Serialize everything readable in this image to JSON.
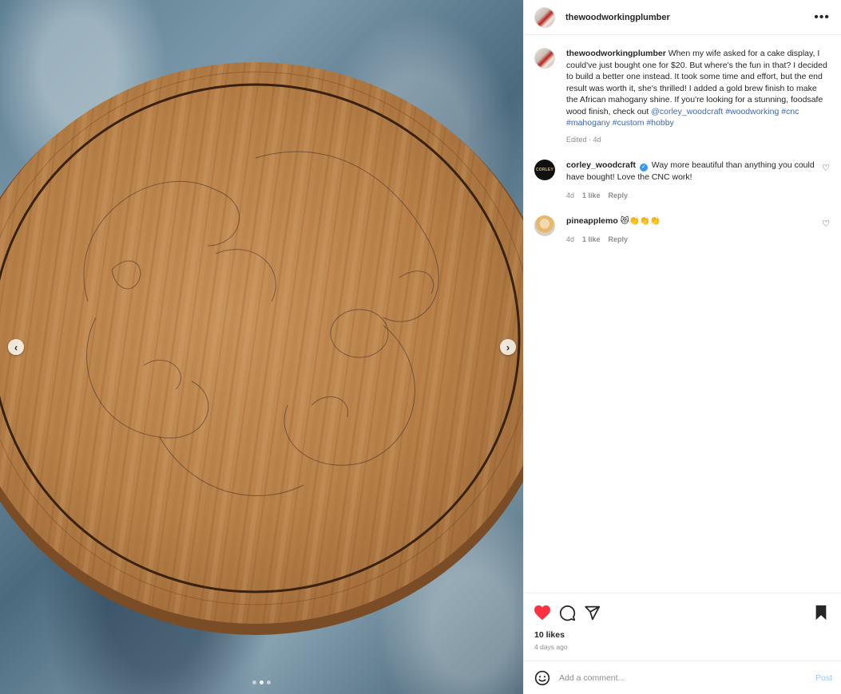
{
  "post": {
    "owner": "thewoodworkingplumber",
    "more_icon": "more-horizontal-icon"
  },
  "caption": {
    "username": "thewoodworkingplumber",
    "text": "When my wife asked for a cake display, I could've just bought one for $20. But where's the fun in that? I decided to build a better one instead. It took some time and effort, but the end result was worth it, she's thrilled! I added a gold brew finish to make the African mahogany shine. If you're looking for a stunning, foodsafe wood finish, check out",
    "tags": [
      "@corley_woodcraft",
      "#woodworking",
      "#cnc",
      "#mahogany",
      "#custom",
      "#hobby"
    ],
    "edited": "Edited",
    "age": "4d"
  },
  "comments": [
    {
      "username": "corley_woodcraft",
      "verified": true,
      "text": "Way more beautiful than anything you could have bought! Love the CNC work!",
      "age": "4d",
      "likes": "1 like",
      "reply": "Reply"
    },
    {
      "username": "pineapplemo",
      "verified": false,
      "text": "😻👏👏👏",
      "age": "4d",
      "likes": "1 like",
      "reply": "Reply"
    }
  ],
  "actions": {
    "liked": true,
    "like_color": "#ff3040",
    "likes_count": "10 likes",
    "timestamp": "4 days ago"
  },
  "composer": {
    "placeholder": "Add a comment...",
    "post_label": "Post",
    "post_color": "#9cc6f4"
  },
  "carousel": {
    "slide_count": 3,
    "active_index": 1,
    "prev_glyph": "‹",
    "next_glyph": "›"
  },
  "colors": {
    "link": "#4166b4",
    "muted": "#8e8e8e",
    "text": "#262626"
  }
}
